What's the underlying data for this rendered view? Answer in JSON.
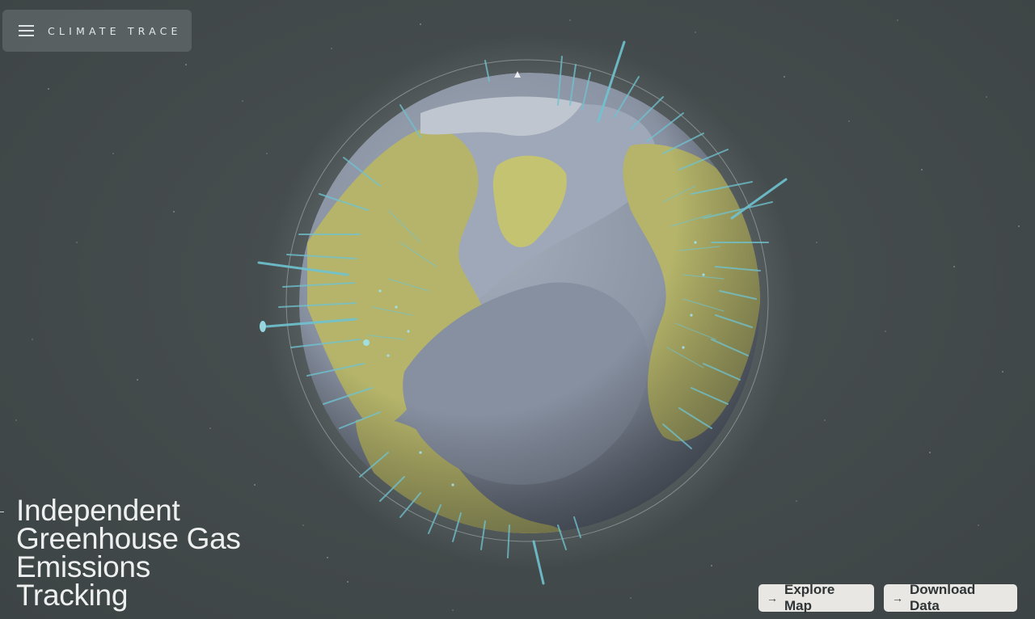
{
  "brand": {
    "name": "CLIMATE TRACE",
    "menu_icon": "hamburger-menu-icon"
  },
  "hero": {
    "headline_lines": [
      "Independent",
      "Greenhouse Gas",
      "Emissions",
      "Tracking"
    ]
  },
  "actions": {
    "explore_label": "Explore Map",
    "download_label": "Download Data",
    "arrow_icon": "arrow-right-icon"
  },
  "colors": {
    "background": "#444b4c",
    "ocean": "#8b94a4",
    "land": "#b9b86a",
    "ice": "#b8c0c8",
    "emission_bars": "#6fc3d1",
    "button": "#e8e7e3"
  }
}
